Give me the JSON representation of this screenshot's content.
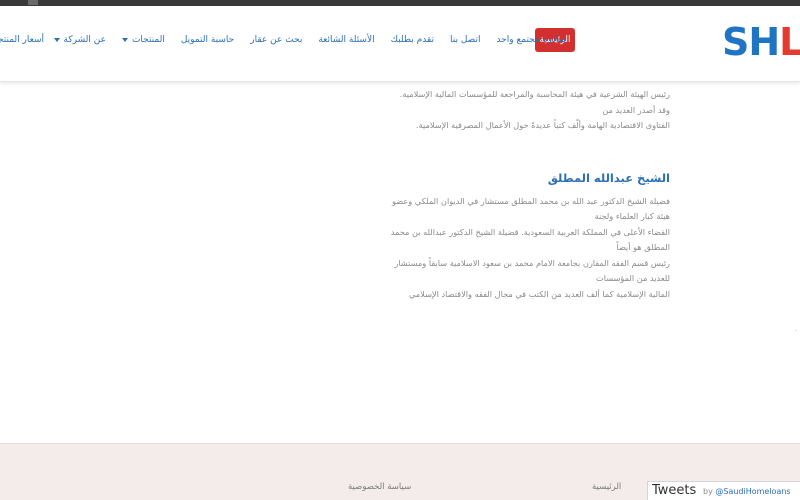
{
  "header": {
    "logo_part1": "SH",
    "logo_part2": "L",
    "nav_home": "الرئيسية",
    "nav_items": [
      {
        "label": "عن الشركة",
        "dropdown": true
      },
      {
        "label": "المنتجات",
        "dropdown": true
      },
      {
        "label": "حاسبة التمويل",
        "dropdown": false
      },
      {
        "label": "بحث عن عقار",
        "dropdown": false
      },
      {
        "label": "الأسئلة الشائعة",
        "dropdown": false
      },
      {
        "label": "تقدم بطلبك",
        "dropdown": false
      },
      {
        "label": "اتصل بنا",
        "dropdown": false
      },
      {
        "label": "مبادرة مجتمع واحد",
        "dropdown": false
      }
    ],
    "nav_clipped": "أسعار المنتجات"
  },
  "content": {
    "section1_lines": [
      "رئيس الهيئة الشرعية في هيئة المحاسبة والمراجعة للمؤسسات المالية الإسلامية. وقد أصدر العديد من",
      "الفتاوى الاقتصادية الهامة وألّف كتباً عديدةً حول الأعمال المصرفية الإسلامية."
    ],
    "person_name": "الشيخ عبدالله المطلق",
    "section2_lines": [
      "فضيلة الشيخ الدكتور عبد الله بن محمد المطلق مستشار في الديوان الملكي وعضو هيئة كبار العلماء ولجنة",
      "القضاء الأعلى في المملكة العربية السعودية. فضيلة الشيخ الدكتور عبدالله بن محمد المطلق هو أيضاً",
      "رئيس قسم الفقه المقارن بجامعة الامام محمد بن سعود الاسلامية سابقاً ومستشار للعديد من المؤسسات",
      "المالية الإسلامية كما ألف العديد من الكتب في مجال الفقه والاقتصاد الإسلامي"
    ]
  },
  "side_mark": ".",
  "footer": {
    "link_home": "الرئيسية",
    "link_privacy": "سياسة الخصوصية",
    "tweets_title": "Tweets",
    "tweets_by": "by",
    "tweets_handle": "@SaudiHomeloans"
  },
  "colors": {
    "brand_blue": "#1f74c4",
    "brand_red": "#e53b2e",
    "link_blue": "#2b6fb5",
    "home_red": "#d32f2f",
    "footer_bg": "#f3ecea"
  }
}
